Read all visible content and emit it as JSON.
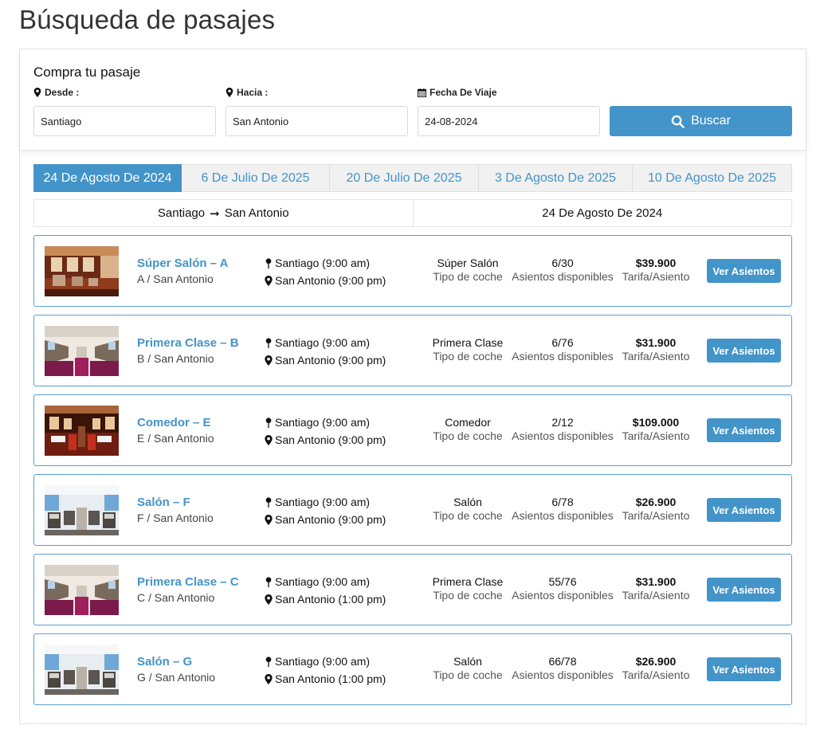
{
  "page": {
    "title": "Búsqueda de pasajes"
  },
  "search": {
    "heading": "Compra tu pasaje",
    "from_label": "Desde :",
    "to_label": "Hacia :",
    "date_label": "Fecha De Viaje",
    "from_value": "Santiago",
    "to_value": "San Antonio",
    "date_value": "24-08-2024",
    "button_label": "Buscar"
  },
  "date_tabs": [
    {
      "label": "24 De Agosto De 2024",
      "active": true
    },
    {
      "label": "6 De Julio De 2025",
      "active": false
    },
    {
      "label": "20 De Julio De 2025",
      "active": false
    },
    {
      "label": "3 De Agosto De 2025",
      "active": false
    },
    {
      "label": "10 De Agosto De 2025",
      "active": false
    }
  ],
  "route_bar": {
    "origin": "Santiago",
    "arrow": "➞",
    "destination": "San Antonio",
    "date": "24 De Agosto De 2024"
  },
  "labels": {
    "car_type": "Tipo de coche",
    "seats_available": "Asientos disponibles",
    "fare": "Tarifa/Asiento",
    "button": "Ver Asientos"
  },
  "trips": [
    {
      "name": "Súper Salón – A",
      "sub": "A / San Antonio",
      "origin": "Santiago (9:00 am)",
      "destination": "San Antonio (9:00 pm)",
      "car_type": "Súper Salón",
      "seats": "6/30",
      "fare": "$39.900",
      "image": "wood-salon-car-photo"
    },
    {
      "name": "Primera Clase – B",
      "sub": "B / San Antonio",
      "origin": "Santiago (9:00 am)",
      "destination": "San Antonio (9:00 pm)",
      "car_type": "Primera Clase",
      "seats": "6/76",
      "fare": "$31.900",
      "image": "first-class-car-photo"
    },
    {
      "name": "Comedor – E",
      "sub": "E / San Antonio",
      "origin": "Santiago (9:00 am)",
      "destination": "San Antonio (9:00 pm)",
      "car_type": "Comedor",
      "seats": "2/12",
      "fare": "$109.000",
      "image": "dining-car-photo"
    },
    {
      "name": "Salón – F",
      "sub": "F / San Antonio",
      "origin": "Santiago (9:00 am)",
      "destination": "San Antonio (9:00 pm)",
      "car_type": "Salón",
      "seats": "6/78",
      "fare": "$26.900",
      "image": "salon-car-photo"
    },
    {
      "name": "Primera Clase – C",
      "sub": "C / San Antonio",
      "origin": "Santiago (9:00 am)",
      "destination": "San Antonio (1:00 pm)",
      "car_type": "Primera Clase",
      "seats": "55/76",
      "fare": "$31.900",
      "image": "first-class-car-photo"
    },
    {
      "name": "Salón – G",
      "sub": "G / San Antonio",
      "origin": "Santiago (9:00 am)",
      "destination": "San Antonio (1:00 pm)",
      "car_type": "Salón",
      "seats": "66/78",
      "fare": "$26.900",
      "image": "salon-car-photo"
    }
  ],
  "colors": {
    "accent": "#4394c8",
    "card_border": "#5a9fcf",
    "tab_inactive_bg": "#f1f1f1"
  },
  "icons": {
    "location": "map-marker-icon",
    "calendar": "calendar-icon",
    "search": "search-icon"
  }
}
